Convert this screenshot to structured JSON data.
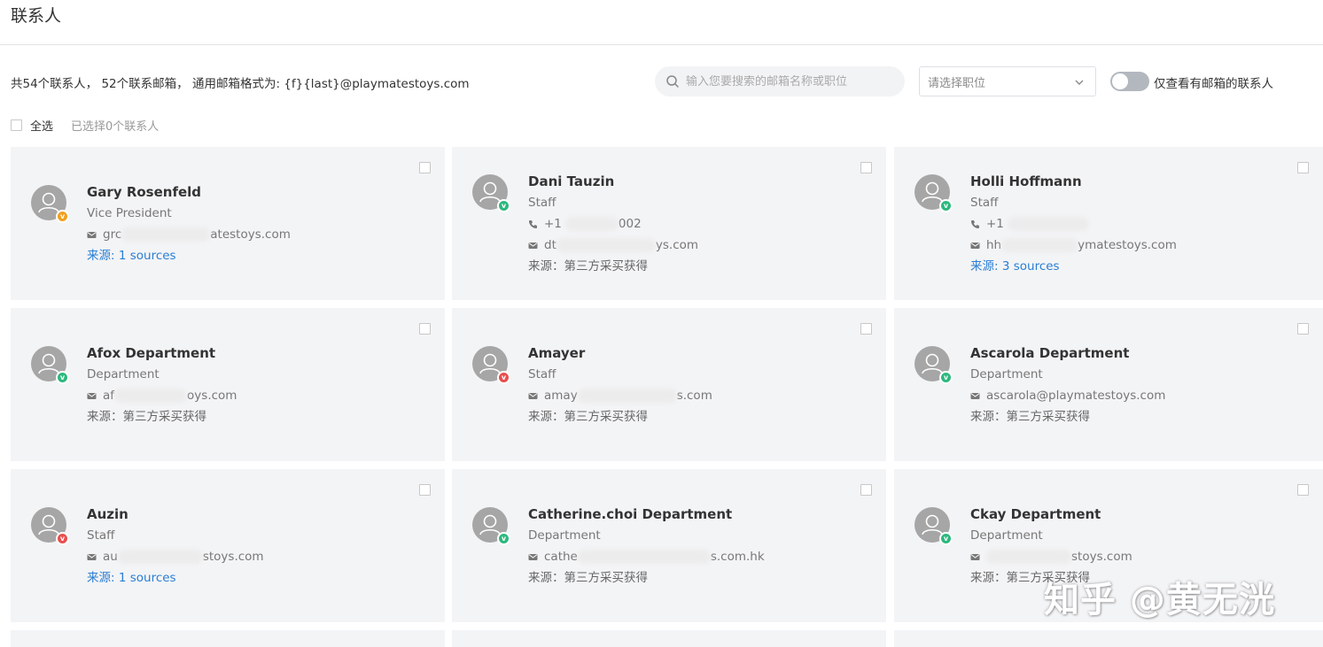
{
  "header": {
    "title": "联系人"
  },
  "summary": {
    "text": "共54个联系人， 52个联系邮箱， 通用邮箱格式为: {f}{last}@playmatestoys.com"
  },
  "search": {
    "placeholder": "输入您要搜索的邮箱名称或职位",
    "icon": "search-icon"
  },
  "position_select": {
    "placeholder": "请选择职位",
    "icon": "chevron-down-icon"
  },
  "email_toggle": {
    "label": "仅查看有邮箱的联系人",
    "on": false
  },
  "select_all": {
    "label": "全选",
    "selected_text": "已选择0个联系人"
  },
  "colors": {
    "badge_green": "#2db87d",
    "badge_orange": "#f0a020",
    "badge_red": "#e94e4e",
    "link_blue": "#2a7ed3",
    "card_bg": "#f3f4f6"
  },
  "contacts": [
    {
      "name": "Gary Rosenfeld",
      "title": "Vice President",
      "email_prefix": "grc",
      "email_suffix": "atestoys.com",
      "source": "来源: 1 sources",
      "source_is_link": true,
      "badge": "orange",
      "badge_text": "v"
    },
    {
      "name": "Dani Tauzin",
      "title": "Staff",
      "phone_prefix": "+1",
      "phone_suffix": "002",
      "email_prefix": "dt",
      "email_suffix": "ys.com",
      "source": "来源：第三方采买获得",
      "source_is_link": false,
      "badge": "green",
      "badge_text": "v"
    },
    {
      "name": "Holli Hoffmann",
      "title": "Staff",
      "phone_prefix": "+1",
      "phone_suffix": "",
      "email_prefix": "hh",
      "email_suffix": "ymatestoys.com",
      "source": "来源: 3 sources",
      "source_is_link": true,
      "badge": "green",
      "badge_text": "v"
    },
    {
      "name": "Afox Department",
      "title": "Department",
      "email_prefix": "af",
      "email_suffix": "oys.com",
      "source": "来源：第三方采买获得",
      "source_is_link": false,
      "badge": "green",
      "badge_text": "v"
    },
    {
      "name": "Amayer",
      "title": "Staff",
      "email_prefix": "amay",
      "email_suffix": "s.com",
      "source": "来源：第三方采买获得",
      "source_is_link": false,
      "badge": "red",
      "badge_text": "v"
    },
    {
      "name": "Ascarola Department",
      "title": "Department",
      "email_prefix": "ascarola@playmatestoys.com",
      "email_suffix": "",
      "source": "来源：第三方采买获得",
      "source_is_link": false,
      "badge": "green",
      "badge_text": "v"
    },
    {
      "name": "Auzin",
      "title": "Staff",
      "email_prefix": "au",
      "email_suffix": "stoys.com",
      "source": "来源: 1 sources",
      "source_is_link": true,
      "badge": "red",
      "badge_text": "v"
    },
    {
      "name": "Catherine.choi Department",
      "title": "Department",
      "email_prefix": "cathe",
      "email_suffix": "s.com.hk",
      "source": "来源：第三方采买获得",
      "source_is_link": false,
      "badge": "green",
      "badge_text": "v"
    },
    {
      "name": "Ckay Department",
      "title": "Department",
      "email_prefix": "",
      "email_suffix": "stoys.com",
      "source": "来源：第三方采买获得",
      "source_is_link": false,
      "badge": "green",
      "badge_text": "v"
    }
  ],
  "watermark": {
    "text": "知乎 @黄无洸"
  }
}
